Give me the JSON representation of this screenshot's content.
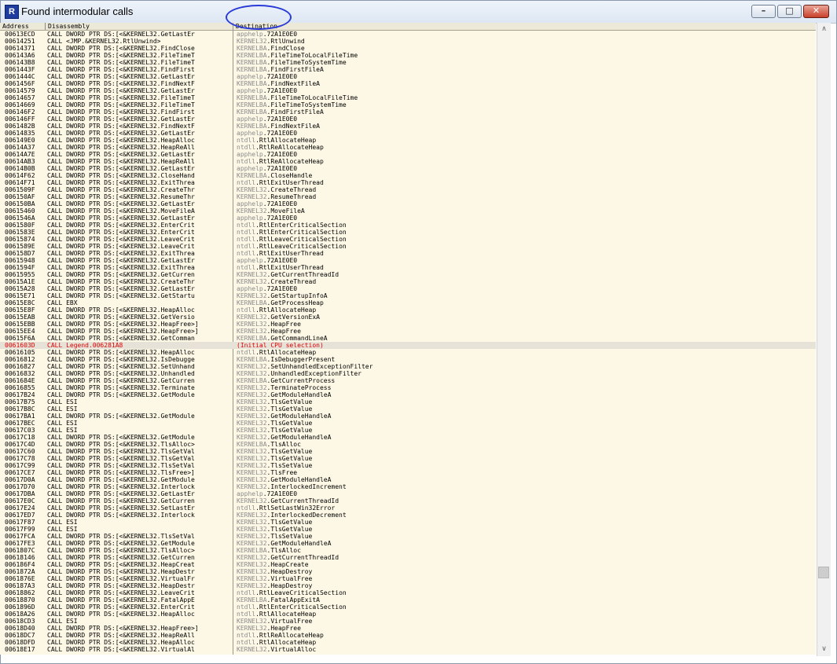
{
  "window": {
    "title": "Found intermodular calls",
    "icon_letter": "R",
    "minimize_glyph": "–",
    "maximize_glyph": "□",
    "close_glyph": "✕"
  },
  "columns": {
    "address": "Address",
    "disassembly": "Disassembly",
    "destination": "Destination"
  },
  "scrollbar": {
    "up_glyph": "∧",
    "down_glyph": "∨"
  },
  "colors": {
    "selected_text": "#e00000",
    "background": "#fdf8e6",
    "annotation": "#2a3bd8"
  },
  "rows": [
    {
      "addr": "00613ECD",
      "dis": "CALL DWORD PTR DS:[<&KERNEL32.GetLastEr",
      "mod": "apphelp",
      "fn": "72A1E0E0"
    },
    {
      "addr": "00614251",
      "dis": "CALL <JMP.&KERNEL32.RtlUnwind>",
      "mod": "KERNEL32",
      "fn": "RtlUnwind"
    },
    {
      "addr": "00614371",
      "dis": "CALL DWORD PTR DS:[<&KERNEL32.FindClose",
      "mod": "KERNELBA",
      "fn": "FindClose"
    },
    {
      "addr": "006143A6",
      "dis": "CALL DWORD PTR DS:[<&KERNEL32.FileTimeT",
      "mod": "KERNELBA",
      "fn": "FileTimeToLocalFileTime"
    },
    {
      "addr": "006143B8",
      "dis": "CALL DWORD PTR DS:[<&KERNEL32.FileTimeT",
      "mod": "KERNELBA",
      "fn": "FileTimeToSystemTime"
    },
    {
      "addr": "0061443F",
      "dis": "CALL DWORD PTR DS:[<&KERNEL32.FindFirst",
      "mod": "KERNELBA",
      "fn": "FindFirstFileA"
    },
    {
      "addr": "0061444C",
      "dis": "CALL DWORD PTR DS:[<&KERNEL32.GetLastEr",
      "mod": "apphelp",
      "fn": "72A1E0E0"
    },
    {
      "addr": "0061456F",
      "dis": "CALL DWORD PTR DS:[<&KERNEL32.FindNextF",
      "mod": "KERNELBA",
      "fn": "FindNextFileA"
    },
    {
      "addr": "00614579",
      "dis": "CALL DWORD PTR DS:[<&KERNEL32.GetLastEr",
      "mod": "apphelp",
      "fn": "72A1E0E0"
    },
    {
      "addr": "00614657",
      "dis": "CALL DWORD PTR DS:[<&KERNEL32.FileTimeT",
      "mod": "KERNELBA",
      "fn": "FileTimeToLocalFileTime"
    },
    {
      "addr": "00614669",
      "dis": "CALL DWORD PTR DS:[<&KERNEL32.FileTimeT",
      "mod": "KERNELBA",
      "fn": "FileTimeToSystemTime"
    },
    {
      "addr": "006146F2",
      "dis": "CALL DWORD PTR DS:[<&KERNEL32.FindFirst",
      "mod": "KERNELBA",
      "fn": "FindFirstFileA"
    },
    {
      "addr": "006146FF",
      "dis": "CALL DWORD PTR DS:[<&KERNEL32.GetLastEr",
      "mod": "apphelp",
      "fn": "72A1E0E0"
    },
    {
      "addr": "0061482B",
      "dis": "CALL DWORD PTR DS:[<&KERNEL32.FindNextF",
      "mod": "KERNELBA",
      "fn": "FindNextFileA"
    },
    {
      "addr": "00614835",
      "dis": "CALL DWORD PTR DS:[<&KERNEL32.GetLastEr",
      "mod": "apphelp",
      "fn": "72A1E0E0"
    },
    {
      "addr": "006149E0",
      "dis": "CALL DWORD PTR DS:[<&KERNEL32.HeapAlloc",
      "mod": "ntdll",
      "fn": "RtlAllocateHeap"
    },
    {
      "addr": "00614A37",
      "dis": "CALL DWORD PTR DS:[<&KERNEL32.HeapReAll",
      "mod": "ntdll",
      "fn": "RtlReAllocateHeap"
    },
    {
      "addr": "00614A7E",
      "dis": "CALL DWORD PTR DS:[<&KERNEL32.GetLastEr",
      "mod": "apphelp",
      "fn": "72A1E0E0"
    },
    {
      "addr": "00614AB3",
      "dis": "CALL DWORD PTR DS:[<&KERNEL32.HeapReAll",
      "mod": "ntdll",
      "fn": "RtlReAllocateHeap"
    },
    {
      "addr": "00614B0B",
      "dis": "CALL DWORD PTR DS:[<&KERNEL32.GetLastEr",
      "mod": "apphelp",
      "fn": "72A1E0E0"
    },
    {
      "addr": "00614F62",
      "dis": "CALL DWORD PTR DS:[<&KERNEL32.CloseHand",
      "mod": "KERNELBA",
      "fn": "CloseHandle"
    },
    {
      "addr": "00614F71",
      "dis": "CALL DWORD PTR DS:[<&KERNEL32.ExitThrea",
      "mod": "ntdll",
      "fn": "RtlExitUserThread"
    },
    {
      "addr": "0061509F",
      "dis": "CALL DWORD PTR DS:[<&KERNEL32.CreateThr",
      "mod": "KERNEL32",
      "fn": "CreateThread"
    },
    {
      "addr": "006150AF",
      "dis": "CALL DWORD PTR DS:[<&KERNEL32.ResumeThr",
      "mod": "KERNEL32",
      "fn": "ResumeThread"
    },
    {
      "addr": "006150BA",
      "dis": "CALL DWORD PTR DS:[<&KERNEL32.GetLastEr",
      "mod": "apphelp",
      "fn": "72A1E0E0"
    },
    {
      "addr": "00615460",
      "dis": "CALL DWORD PTR DS:[<&KERNEL32.MoveFileA",
      "mod": "KERNEL32",
      "fn": "MoveFileA"
    },
    {
      "addr": "0061546A",
      "dis": "CALL DWORD PTR DS:[<&KERNEL32.GetLastEr",
      "mod": "apphelp",
      "fn": "72A1E0E0"
    },
    {
      "addr": "0061580F",
      "dis": "CALL DWORD PTR DS:[<&KERNEL32.EnterCrit",
      "mod": "ntdll",
      "fn": "RtlEnterCriticalSection"
    },
    {
      "addr": "0061583E",
      "dis": "CALL DWORD PTR DS:[<&KERNEL32.EnterCrit",
      "mod": "ntdll",
      "fn": "RtlEnterCriticalSection"
    },
    {
      "addr": "00615874",
      "dis": "CALL DWORD PTR DS:[<&KERNEL32.LeaveCrit",
      "mod": "ntdll",
      "fn": "RtlLeaveCriticalSection"
    },
    {
      "addr": "0061589E",
      "dis": "CALL DWORD PTR DS:[<&KERNEL32.LeaveCrit",
      "mod": "ntdll",
      "fn": "RtlLeaveCriticalSection"
    },
    {
      "addr": "006158D7",
      "dis": "CALL DWORD PTR DS:[<&KERNEL32.ExitThrea",
      "mod": "ntdll",
      "fn": "RtlExitUserThread"
    },
    {
      "addr": "00615948",
      "dis": "CALL DWORD PTR DS:[<&KERNEL32.GetLastEr",
      "mod": "apphelp",
      "fn": "72A1E0E0"
    },
    {
      "addr": "0061594F",
      "dis": "CALL DWORD PTR DS:[<&KERNEL32.ExitThrea",
      "mod": "ntdll",
      "fn": "RtlExitUserThread"
    },
    {
      "addr": "00615955",
      "dis": "CALL DWORD PTR DS:[<&KERNEL32.GetCurren",
      "mod": "KERNEL32",
      "fn": "GetCurrentThreadId"
    },
    {
      "addr": "00615A1E",
      "dis": "CALL DWORD PTR DS:[<&KERNEL32.CreateThr",
      "mod": "KERNEL32",
      "fn": "CreateThread"
    },
    {
      "addr": "00615A28",
      "dis": "CALL DWORD PTR DS:[<&KERNEL32.GetLastEr",
      "mod": "apphelp",
      "fn": "72A1E0E0"
    },
    {
      "addr": "00615E71",
      "dis": "CALL DWORD PTR DS:[<&KERNEL32.GetStartu",
      "mod": "KERNEL32",
      "fn": "GetStartupInfoA"
    },
    {
      "addr": "00615E8C",
      "dis": "CALL EBX",
      "mod": "KERNELBA",
      "fn": "GetProcessHeap"
    },
    {
      "addr": "00615E8F",
      "dis": "CALL DWORD PTR DS:[<&KERNEL32.HeapAlloc",
      "mod": "ntdll",
      "fn": "RtlAllocateHeap"
    },
    {
      "addr": "00615EAB",
      "dis": "CALL DWORD PTR DS:[<&KERNEL32.GetVersio",
      "mod": "KERNEL32",
      "fn": "GetVersionExA"
    },
    {
      "addr": "00615EBB",
      "dis": "CALL DWORD PTR DS:[<&KERNEL32.HeapFree>]",
      "mod": "KERNEL32",
      "fn": "HeapFree"
    },
    {
      "addr": "00615EE4",
      "dis": "CALL DWORD PTR DS:[<&KERNEL32.HeapFree>]",
      "mod": "KERNEL32",
      "fn": "HeapFree"
    },
    {
      "addr": "00615F6A",
      "dis": "CALL DWORD PTR DS:[<&KERNEL32.GetComman",
      "mod": "KERNELBA",
      "fn": "GetCommandLineA"
    },
    {
      "addr": "0061603D",
      "dis": "CALL Legend.006281A8",
      "mod": "",
      "fn": "(Initial CPU selection)",
      "selected": true
    },
    {
      "addr": "00616105",
      "dis": "CALL DWORD PTR DS:[<&KERNEL32.HeapAlloc",
      "mod": "ntdll",
      "fn": "RtlAllocateHeap"
    },
    {
      "addr": "00616812",
      "dis": "CALL DWORD PTR DS:[<&KERNEL32.IsDebugge",
      "mod": "KERNELBA",
      "fn": "IsDebuggerPresent"
    },
    {
      "addr": "00616827",
      "dis": "CALL DWORD PTR DS:[<&KERNEL32.SetUnhand",
      "mod": "KERNEL32",
      "fn": "SetUnhandledExceptionFilter"
    },
    {
      "addr": "00616832",
      "dis": "CALL DWORD PTR DS:[<&KERNEL32.Unhandled",
      "mod": "KERNEL32",
      "fn": "UnhandledExceptionFilter"
    },
    {
      "addr": "0061684E",
      "dis": "CALL DWORD PTR DS:[<&KERNEL32.GetCurren",
      "mod": "KERNELBA",
      "fn": "GetCurrentProcess"
    },
    {
      "addr": "00616855",
      "dis": "CALL DWORD PTR DS:[<&KERNEL32.Terminate",
      "mod": "KERNEL32",
      "fn": "TerminateProcess"
    },
    {
      "addr": "00617B24",
      "dis": "CALL DWORD PTR DS:[<&KERNEL32.GetModule",
      "mod": "KERNEL32",
      "fn": "GetModuleHandleA"
    },
    {
      "addr": "00617B75",
      "dis": "CALL ESI",
      "mod": "KERNEL32",
      "fn": "TlsGetValue"
    },
    {
      "addr": "00617B8C",
      "dis": "CALL ESI",
      "mod": "KERNEL32",
      "fn": "TlsGetValue"
    },
    {
      "addr": "00617BA1",
      "dis": "CALL DWORD PTR DS:[<&KERNEL32.GetModule",
      "mod": "KERNEL32",
      "fn": "GetModuleHandleA"
    },
    {
      "addr": "00617BEC",
      "dis": "CALL ESI",
      "mod": "KERNEL32",
      "fn": "TlsGetValue"
    },
    {
      "addr": "00617C03",
      "dis": "CALL ESI",
      "mod": "KERNEL32",
      "fn": "TlsGetValue"
    },
    {
      "addr": "00617C18",
      "dis": "CALL DWORD PTR DS:[<&KERNEL32.GetModule",
      "mod": "KERNEL32",
      "fn": "GetModuleHandleA"
    },
    {
      "addr": "00617C4D",
      "dis": "CALL DWORD PTR DS:[<&KERNEL32.TlsAlloc>",
      "mod": "KERNELBA",
      "fn": "TlsAlloc"
    },
    {
      "addr": "00617C60",
      "dis": "CALL DWORD PTR DS:[<&KERNEL32.TlsGetVal",
      "mod": "KERNEL32",
      "fn": "TlsGetValue"
    },
    {
      "addr": "00617C78",
      "dis": "CALL DWORD PTR DS:[<&KERNEL32.TlsGetVal",
      "mod": "KERNEL32",
      "fn": "TlsGetValue"
    },
    {
      "addr": "00617C99",
      "dis": "CALL DWORD PTR DS:[<&KERNEL32.TlsSetVal",
      "mod": "KERNEL32",
      "fn": "TlsSetValue"
    },
    {
      "addr": "00617CE7",
      "dis": "CALL DWORD PTR DS:[<&KERNEL32.TlsFree>]",
      "mod": "KERNEL32",
      "fn": "TlsFree"
    },
    {
      "addr": "00617D0A",
      "dis": "CALL DWORD PTR DS:[<&KERNEL32.GetModule",
      "mod": "KERNEL32",
      "fn": "GetModuleHandleA"
    },
    {
      "addr": "00617D70",
      "dis": "CALL DWORD PTR DS:[<&KERNEL32.Interlock",
      "mod": "KERNEL32",
      "fn": "InterlockedIncrement"
    },
    {
      "addr": "00617DBA",
      "dis": "CALL DWORD PTR DS:[<&KERNEL32.GetLastEr",
      "mod": "apphelp",
      "fn": "72A1E0E0"
    },
    {
      "addr": "00617E0C",
      "dis": "CALL DWORD PTR DS:[<&KERNEL32.GetCurren",
      "mod": "KERNEL32",
      "fn": "GetCurrentThreadId"
    },
    {
      "addr": "00617E24",
      "dis": "CALL DWORD PTR DS:[<&KERNEL32.SetLastEr",
      "mod": "ntdll",
      "fn": "RtlSetLastWin32Error"
    },
    {
      "addr": "00617ED7",
      "dis": "CALL DWORD PTR DS:[<&KERNEL32.Interlock",
      "mod": "KERNEL32",
      "fn": "InterlockedDecrement"
    },
    {
      "addr": "00617F87",
      "dis": "CALL ESI",
      "mod": "KERNEL32",
      "fn": "TlsGetValue"
    },
    {
      "addr": "00617F99",
      "dis": "CALL ESI",
      "mod": "KERNEL32",
      "fn": "TlsGetValue"
    },
    {
      "addr": "00617FCA",
      "dis": "CALL DWORD PTR DS:[<&KERNEL32.TlsSetVal",
      "mod": "KERNEL32",
      "fn": "TlsSetValue"
    },
    {
      "addr": "00617FE3",
      "dis": "CALL DWORD PTR DS:[<&KERNEL32.GetModule",
      "mod": "KERNEL32",
      "fn": "GetModuleHandleA"
    },
    {
      "addr": "0061807C",
      "dis": "CALL DWORD PTR DS:[<&KERNEL32.TlsAlloc>",
      "mod": "KERNELBA",
      "fn": "TlsAlloc"
    },
    {
      "addr": "00618146",
      "dis": "CALL DWORD PTR DS:[<&KERNEL32.GetCurren",
      "mod": "KERNEL32",
      "fn": "GetCurrentThreadId"
    },
    {
      "addr": "006186F4",
      "dis": "CALL DWORD PTR DS:[<&KERNEL32.HeapCreat",
      "mod": "KERNEL32",
      "fn": "HeapCreate"
    },
    {
      "addr": "0061872A",
      "dis": "CALL DWORD PTR DS:[<&KERNEL32.HeapDestr",
      "mod": "KERNEL32",
      "fn": "HeapDestroy"
    },
    {
      "addr": "0061876E",
      "dis": "CALL DWORD PTR DS:[<&KERNEL32.VirtualFr",
      "mod": "KERNEL32",
      "fn": "VirtualFree"
    },
    {
      "addr": "006187A3",
      "dis": "CALL DWORD PTR DS:[<&KERNEL32.HeapDestr",
      "mod": "KERNEL32",
      "fn": "HeapDestroy"
    },
    {
      "addr": "00618862",
      "dis": "CALL DWORD PTR DS:[<&KERNEL32.LeaveCrit",
      "mod": "ntdll",
      "fn": "RtlLeaveCriticalSection"
    },
    {
      "addr": "00618870",
      "dis": "CALL DWORD PTR DS:[<&KERNEL32.FatalAppE",
      "mod": "KERNELBA",
      "fn": "FatalAppExitA"
    },
    {
      "addr": "0061896D",
      "dis": "CALL DWORD PTR DS:[<&KERNEL32.EnterCrit",
      "mod": "ntdll",
      "fn": "RtlEnterCriticalSection"
    },
    {
      "addr": "00618A26",
      "dis": "CALL DWORD PTR DS:[<&KERNEL32.HeapAlloc",
      "mod": "ntdll",
      "fn": "RtlAllocateHeap"
    },
    {
      "addr": "00618CD3",
      "dis": "CALL ESI",
      "mod": "KERNEL32",
      "fn": "VirtualFree"
    },
    {
      "addr": "00618D40",
      "dis": "CALL DWORD PTR DS:[<&KERNEL32.HeapFree>]",
      "mod": "KERNEL32",
      "fn": "HeapFree"
    },
    {
      "addr": "00618DC7",
      "dis": "CALL DWORD PTR DS:[<&KERNEL32.HeapReAll",
      "mod": "ntdll",
      "fn": "RtlReAllocateHeap"
    },
    {
      "addr": "00618DFD",
      "dis": "CALL DWORD PTR DS:[<&KERNEL32.HeapAlloc",
      "mod": "ntdll",
      "fn": "RtlAllocateHeap"
    },
    {
      "addr": "00618E17",
      "dis": "CALL DWORD PTR DS:[<&KERNEL32.VirtualAl",
      "mod": "KERNEL32",
      "fn": "VirtualAlloc"
    }
  ]
}
